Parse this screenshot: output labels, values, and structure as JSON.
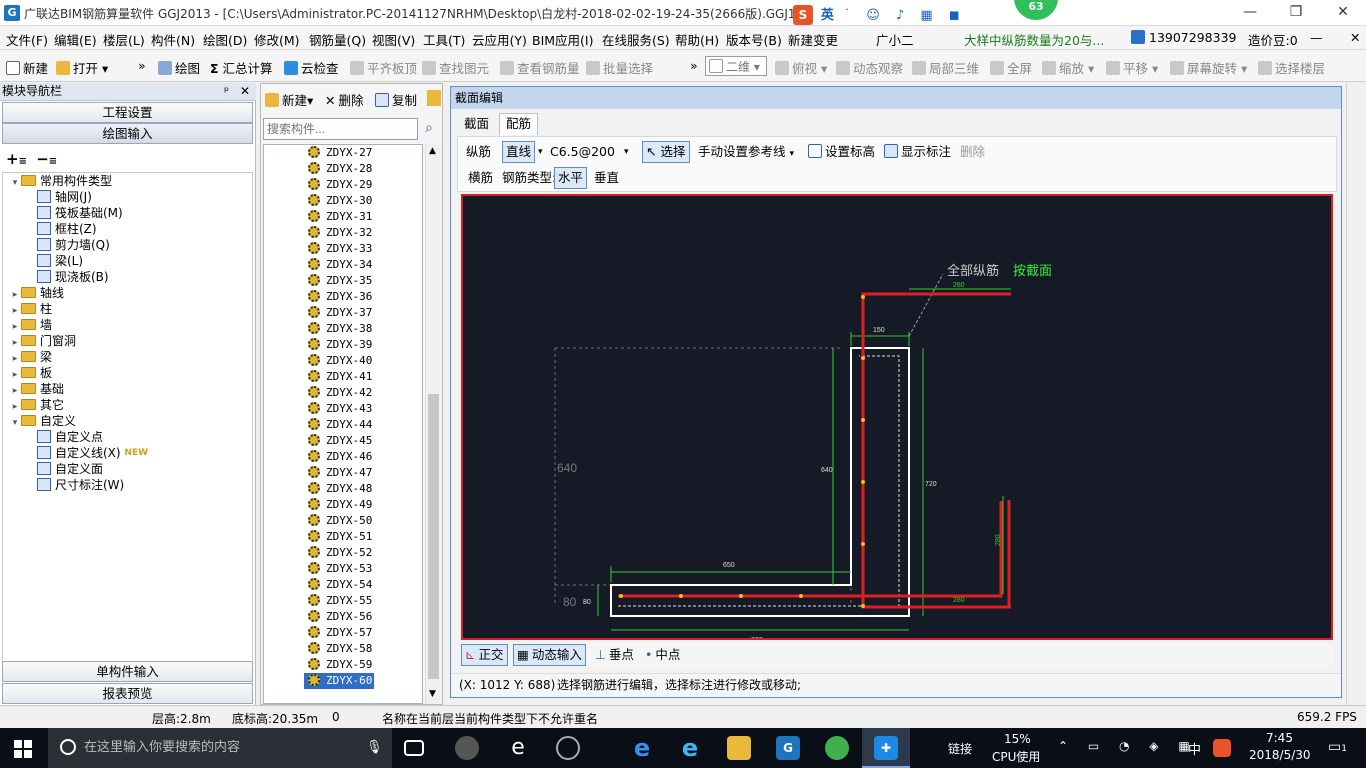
{
  "window": {
    "title": "广联达BIM钢筋算量软件 GGJ2013 - [C:\\Users\\Administrator.PC-20141127NRHM\\Desktop\\白龙村-2018-02-02-19-24-35(2666版).GGJ12]",
    "ime_label": "英",
    "badge": "63"
  },
  "menu": {
    "items": [
      "文件(F)",
      "编辑(E)",
      "楼层(L)",
      "构件(N)",
      "绘图(D)",
      "修改(M)",
      "钢筋量(Q)",
      "视图(V)",
      "工具(T)",
      "云应用(Y)",
      "BIM应用(I)",
      "在线服务(S)",
      "帮助(H)",
      "版本号(B)",
      "新建变更",
      "广小二"
    ],
    "notice": "大样中纵筋数量为20与...",
    "phone": "13907298339",
    "coins": "造价豆:0"
  },
  "toolbar": {
    "items": [
      "新建",
      "打开",
      "绘图",
      "汇总计算",
      "云检查",
      "平齐板顶",
      "查找图元",
      "查看钢筋量",
      "批量选择"
    ],
    "view_select": "二维",
    "view_items": [
      "俯视",
      "动态观察",
      "局部三维",
      "全屏",
      "缩放",
      "平移",
      "屏幕旋转",
      "选择楼层"
    ]
  },
  "leftnav": {
    "header": "模块导航栏",
    "btn_project": "工程设置",
    "btn_draw": "绘图输入",
    "btn_single": "单构件输入",
    "btn_report": "报表预览",
    "tree": [
      {
        "label": "常用构件类型",
        "indent": 0,
        "expanded": true,
        "folder": true
      },
      {
        "label": "轴网(J)",
        "indent": 2
      },
      {
        "label": "筏板基础(M)",
        "indent": 2
      },
      {
        "label": "框柱(Z)",
        "indent": 2
      },
      {
        "label": "剪力墙(Q)",
        "indent": 2
      },
      {
        "label": "梁(L)",
        "indent": 2
      },
      {
        "label": "现浇板(B)",
        "indent": 2
      },
      {
        "label": "轴线",
        "indent": 0,
        "folder": true
      },
      {
        "label": "柱",
        "indent": 0,
        "folder": true
      },
      {
        "label": "墙",
        "indent": 0,
        "folder": true
      },
      {
        "label": "门窗洞",
        "indent": 0,
        "folder": true
      },
      {
        "label": "梁",
        "indent": 0,
        "folder": true
      },
      {
        "label": "板",
        "indent": 0,
        "folder": true
      },
      {
        "label": "基础",
        "indent": 0,
        "folder": true
      },
      {
        "label": "其它",
        "indent": 0,
        "folder": true
      },
      {
        "label": "自定义",
        "indent": 0,
        "expanded": true,
        "folder": true
      },
      {
        "label": "自定义点",
        "indent": 2
      },
      {
        "label": "自定义线(X)",
        "indent": 2,
        "badge": "NEW"
      },
      {
        "label": "自定义面",
        "indent": 2
      },
      {
        "label": "尺寸标注(W)",
        "indent": 2
      }
    ]
  },
  "midpanel": {
    "new": "新建",
    "delete": "删除",
    "copy": "复制",
    "search_placeholder": "搜索构件...",
    "items": [
      "ZDYX-27",
      "ZDYX-28",
      "ZDYX-29",
      "ZDYX-30",
      "ZDYX-31",
      "ZDYX-32",
      "ZDYX-33",
      "ZDYX-34",
      "ZDYX-35",
      "ZDYX-36",
      "ZDYX-37",
      "ZDYX-38",
      "ZDYX-39",
      "ZDYX-40",
      "ZDYX-41",
      "ZDYX-42",
      "ZDYX-43",
      "ZDYX-44",
      "ZDYX-45",
      "ZDYX-46",
      "ZDYX-47",
      "ZDYX-48",
      "ZDYX-49",
      "ZDYX-50",
      "ZDYX-51",
      "ZDYX-52",
      "ZDYX-53",
      "ZDYX-54",
      "ZDYX-55",
      "ZDYX-56",
      "ZDYX-57",
      "ZDYX-58",
      "ZDYX-59",
      "ZDYX-60"
    ],
    "selected": "ZDYX-60"
  },
  "editor": {
    "title": "截面编辑",
    "tab_section": "截面",
    "tab_rebar": "配筋",
    "long_rebar": "纵筋",
    "line_mode": "直线",
    "rebar_spec": "C6.5@200",
    "select": "选择",
    "manual_ref": "手动设置参考线",
    "set_elev": "设置标高",
    "show_label": "显示标注",
    "delete": "删除",
    "hor_rebar": "横筋",
    "rebar_type": "钢筋类型:",
    "horizontal": "水平",
    "vertical": "垂直",
    "ortho": "正交",
    "dyn_input": "动态输入",
    "perp": "垂点",
    "mid": "中点",
    "coord": "(X: 1012 Y: 688)",
    "hint": "选择钢筋进行编辑，选择标注进行修改或移动;"
  },
  "drawing": {
    "all_long": "全部纵筋",
    "by_section": "按截面",
    "dims": {
      "d280top": "280",
      "d150": "150",
      "d640r": "640",
      "d720": "720",
      "d640l": "640",
      "d650": "650",
      "d80": "80",
      "d80l": "80",
      "d800": "800",
      "d280b": "280",
      "d280v": "280"
    }
  },
  "status": {
    "floor_height": "层高:2.8m",
    "base_elev": "底标高:20.35m",
    "zero": "0",
    "message": "名称在当前层当前构件类型下不允许重名",
    "fps": "659.2 FPS"
  },
  "taskbar": {
    "search": "在这里输入你要搜索的内容",
    "link": "链接",
    "cpu_pct": "15%",
    "cpu_label": "CPU使用",
    "lang": "中",
    "time": "7:45",
    "date": "2018/5/30",
    "notif": "1"
  },
  "colors": {
    "accent": "#1e73be",
    "canvas_bg": "#161a26",
    "rebar": "#e02020",
    "dim": "#33cc33",
    "highlight": "#2f6dc6"
  }
}
